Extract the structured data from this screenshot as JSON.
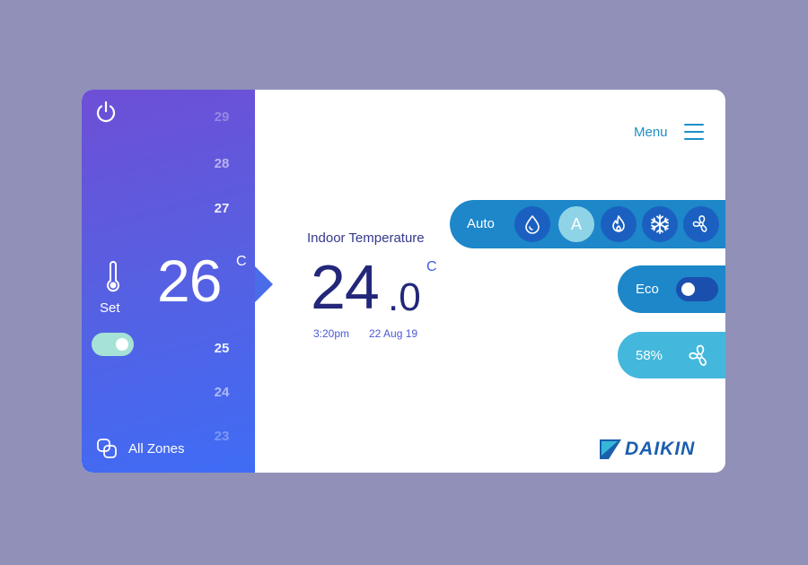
{
  "sidebar": {
    "scale": [
      "29",
      "28",
      "27",
      "25",
      "24",
      "23"
    ],
    "set_label": "Set",
    "setpoint": "26",
    "setpoint_unit": "C",
    "zones_label": "All Zones",
    "toggle_on": true
  },
  "indoor": {
    "title": "Indoor Temperature",
    "whole": "24",
    "decimal": ".0",
    "unit": "C",
    "time": "3:20pm",
    "date": "22 Aug 19"
  },
  "menu": {
    "label": "Menu"
  },
  "modes": {
    "label": "Auto",
    "items": [
      "drop-icon",
      "A",
      "flame-icon",
      "snowflake-icon",
      "fan-icon"
    ],
    "active": "A"
  },
  "eco": {
    "label": "Eco",
    "on": false
  },
  "fan": {
    "speed": "58%"
  },
  "brand": {
    "name": "DAIKIN"
  },
  "colors": {
    "background": "#9090b8",
    "sidebar_start": "#6e4fd6",
    "sidebar_end": "#3f6cf5",
    "mode_bar": "#1d87c9",
    "fan_bar": "#43b8dc",
    "temp_text": "#23277a",
    "accent": "#1e8fc6"
  }
}
